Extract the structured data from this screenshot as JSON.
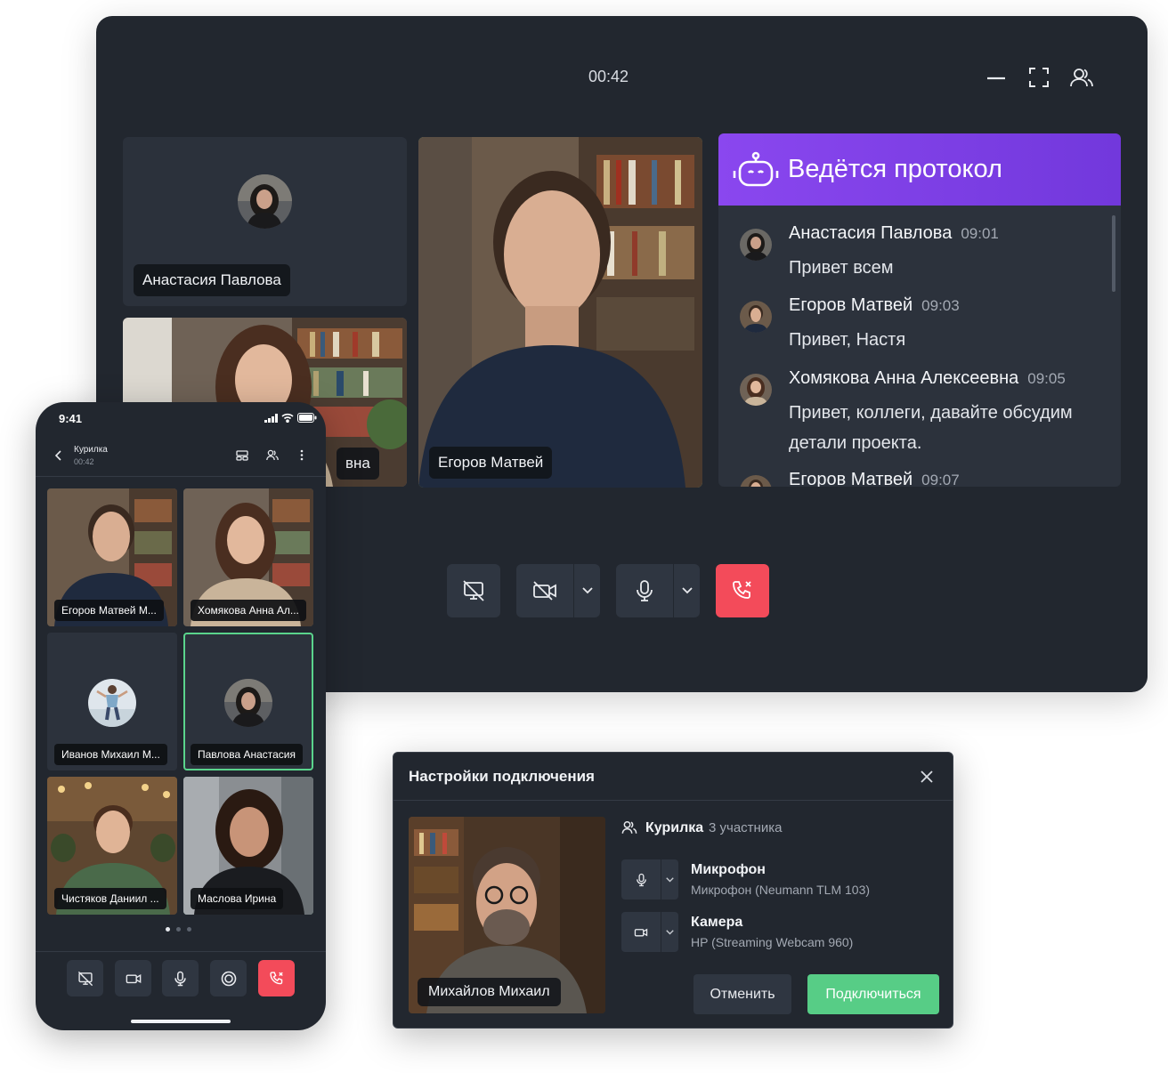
{
  "desktop": {
    "timer": "00:42",
    "tiles": [
      {
        "name": "Анастасия Павлова"
      },
      {
        "name": "вна"
      },
      {
        "name": "Егоров Матвей"
      }
    ],
    "protocol": {
      "title": "Ведётся протокол",
      "messages": [
        {
          "author": "Анастасия Павлова",
          "time": "09:01",
          "text": "Привет всем"
        },
        {
          "author": "Егоров Матвей",
          "time": "09:03",
          "text": "Привет, Настя"
        },
        {
          "author": "Хомякова Анна Алексеевна",
          "time": "09:05",
          "text": "Привет, коллеги, давайте обсудим детали проекта."
        },
        {
          "author": "Егоров Матвей",
          "time": "09:07",
          "text": ""
        }
      ]
    }
  },
  "phone": {
    "clock": "9:41",
    "room": "Курилка",
    "timer": "00:42",
    "participants": [
      {
        "name": "Егоров Матвей М..."
      },
      {
        "name": "Хомякова Анна Ал..."
      },
      {
        "name": "Иванов Михаил М..."
      },
      {
        "name": "Павлова Анастасия"
      },
      {
        "name": "Чистяков Даниил ..."
      },
      {
        "name": "Маслова Ирина"
      }
    ]
  },
  "dialog": {
    "title": "Настройки подключения",
    "preview_name": "Михайлов Михаил",
    "room": "Курилка",
    "participants_count": "3 участника",
    "mic_title": "Микрофон",
    "mic_device": "Микрофон (Neumann TLM 103)",
    "cam_title": "Камера",
    "cam_device": "HP (Streaming Webcam 960)",
    "cancel": "Отменить",
    "connect": "Подключиться"
  },
  "colors": {
    "bg": "#22272f",
    "accent_green": "#57cd86",
    "end_call_red": "#f34b5a",
    "protocol_purple": "#8a47ef"
  }
}
